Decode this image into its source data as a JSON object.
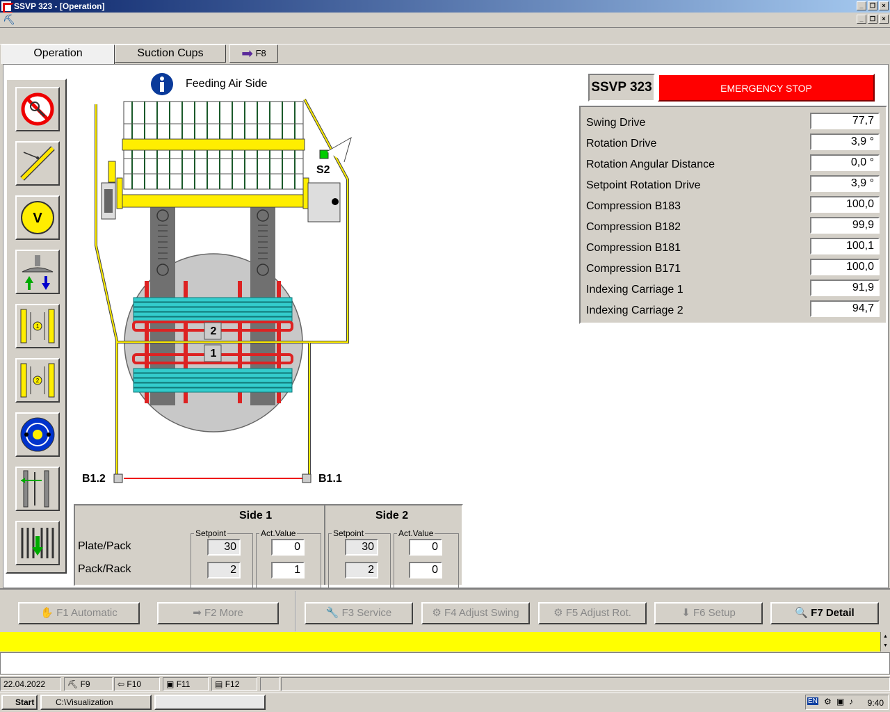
{
  "window": {
    "title": "SSVP 323 - [Operation]"
  },
  "tabs": [
    {
      "label": "Operation"
    },
    {
      "label": "Suction Cups"
    },
    {
      "label": "F8"
    }
  ],
  "diagram": {
    "header": "Feeding Air Side",
    "sensor_s2": "S2",
    "sensor_b12": "B1.2",
    "sensor_b11": "B1.1",
    "marker_2": "2",
    "marker_1": "1"
  },
  "right_panel": {
    "machine": "SSVP 323",
    "emergency": "EMERGENCY STOP",
    "rows": [
      {
        "label": "Swing Drive",
        "value": "77,7"
      },
      {
        "label": "Rotation Drive",
        "value": "3,9 °"
      },
      {
        "label": "Rotation Angular Distance",
        "value": "0,0 °"
      },
      {
        "label": "Setpoint Rotation Drive",
        "value": "3,9 °"
      },
      {
        "label": "Compression B183",
        "value": "100,0"
      },
      {
        "label": "Compression B182",
        "value": "99,9"
      },
      {
        "label": "Compression B181",
        "value": "100,1"
      },
      {
        "label": "Compression B171",
        "value": "100,0"
      },
      {
        "label": "Indexing Carriage 1",
        "value": "91,9"
      },
      {
        "label": "Indexing Carriage 2",
        "value": "94,7"
      }
    ]
  },
  "sides": {
    "side1": "Side 1",
    "side2": "Side 2",
    "setpoint": "Setpoint",
    "actvalue": "Act.Value",
    "row1": "Plate/Pack",
    "row2": "Pack/Rack",
    "s1_plate_set": "30",
    "s1_plate_act": "0",
    "s1_pack_set": "2",
    "s1_pack_act": "1",
    "s2_plate_set": "30",
    "s2_plate_act": "0",
    "s2_pack_set": "2",
    "s2_pack_act": "0"
  },
  "fkeys": {
    "f1": "F1 Automatic",
    "f2": "F2 More",
    "f3": "F3 Service",
    "f4": "F4 Adjust Swing",
    "f5": "F5 Adjust Rot.",
    "f6": "F6 Setup",
    "f7": "F7 Detail"
  },
  "status": {
    "datetime": "22.04.2022 9:40",
    "f9": "F9",
    "f10": "F10",
    "f11": "F11",
    "f12": "F12"
  },
  "taskbar": {
    "start": "Start",
    "folder": "C:\\Visualization",
    "lang": "EN",
    "time": "9:40"
  },
  "colors": {
    "emergency": "#ff0000",
    "status_bar": "#ffff00",
    "plates": "#33cccc",
    "rails": "#dd2222",
    "frame": "#ffee00"
  }
}
